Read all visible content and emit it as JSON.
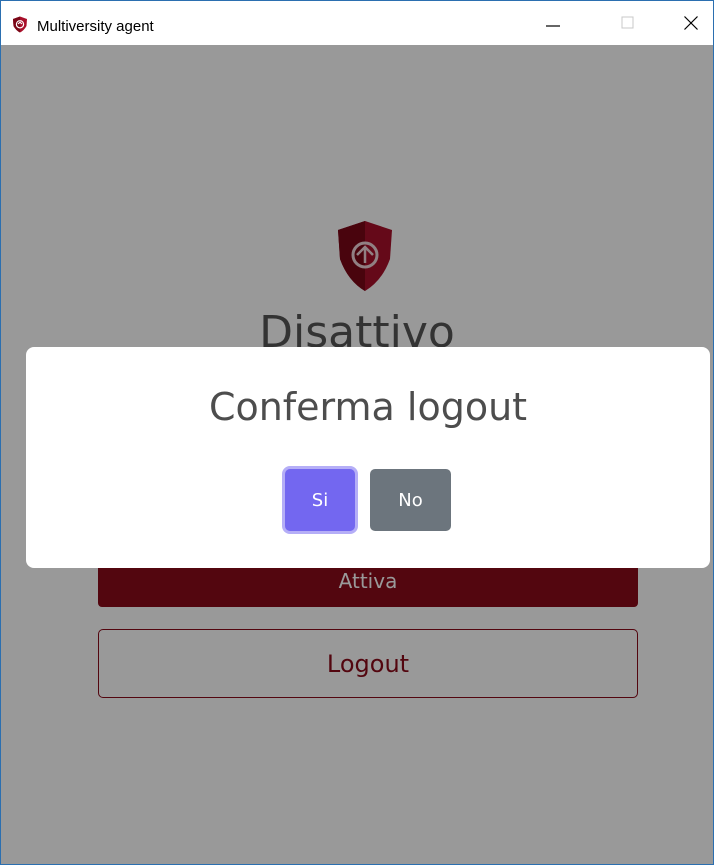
{
  "window": {
    "title": "Multiversity agent",
    "app_icon": "shield-logo-icon",
    "controls": {
      "minimize_icon": "minimize-icon",
      "maximize_icon": "maximize-icon",
      "close_icon": "close-icon"
    }
  },
  "main": {
    "logo_icon": "shield-logo-icon",
    "status_title": "Disattivo",
    "activate_label": "Attiva",
    "logout_label": "Logout"
  },
  "modal": {
    "title": "Conferma logout",
    "yes_label": "Si",
    "no_label": "No"
  },
  "colors": {
    "brand": "#8b0a1a",
    "primary": "#7367f0",
    "secondary": "#6c757d",
    "overlay": "rgba(0,0,0,0.4)"
  }
}
